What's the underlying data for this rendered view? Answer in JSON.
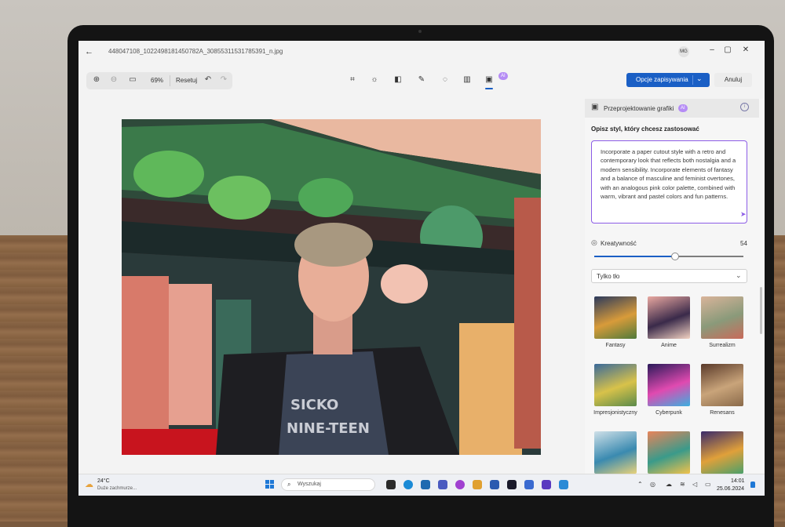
{
  "window": {
    "filename": "448047108_1022498181450782A_30855311531785391_n.jpg",
    "avatar_initials": "MG",
    "controls": {
      "minimize": "–",
      "maximize": "▢",
      "close": "✕"
    }
  },
  "toolbar": {
    "zoom": "69%",
    "reset": "Resetuj",
    "ai_badge": "AI",
    "save_label": "Opcje zapisywania",
    "cancel_label": "Anuluj"
  },
  "panel": {
    "title": "Przeprojektowanie grafiki",
    "ai_badge": "AI",
    "describe_label": "Opisz styl, który chcesz zastosować",
    "prompt": "Incorporate a paper cutout style with a retro and contemporary look that reflects both nostalgia and a modern sensibility. Incorporate elements of fantasy and a balance of masculine and feminist overtones, with an analogous pink color palette, combined with warm, vibrant and pastel colors and fun patterns.",
    "creativity_label": "Kreatywność",
    "creativity_value": "54",
    "creativity_level": 0.54,
    "scope_select": "Tylko tło",
    "styles": [
      {
        "label": "Fantasy",
        "colors": [
          "#2b3a5c",
          "#d89b3a",
          "#4f7a3a"
        ]
      },
      {
        "label": "Anime",
        "colors": [
          "#e9a8a0",
          "#3a2a4a",
          "#f2d2c2"
        ]
      },
      {
        "label": "Surrealizm",
        "colors": [
          "#d9b49a",
          "#8a9a7a",
          "#c96a5a"
        ]
      },
      {
        "label": "Impresjonistyczny",
        "colors": [
          "#3a6a9a",
          "#d8c24a",
          "#5a8a4a"
        ]
      },
      {
        "label": "Cyberpunk",
        "colors": [
          "#2a1a5a",
          "#e04ab0",
          "#3ab0e0"
        ]
      },
      {
        "label": "Renesans",
        "colors": [
          "#5a3a2a",
          "#c9a47a",
          "#8a6a4a"
        ]
      },
      {
        "label": "",
        "colors": [
          "#cfe0e8",
          "#3a8ab0",
          "#e8d27a"
        ]
      },
      {
        "label": "",
        "colors": [
          "#e8845a",
          "#3a9a8a",
          "#f2c24a"
        ]
      },
      {
        "label": "",
        "colors": [
          "#3a2a6a",
          "#e0a03a",
          "#4aa06a"
        ]
      }
    ]
  },
  "taskbar": {
    "weather_temp": "24°C",
    "weather_desc": "Duże zachmurze...",
    "search_placeholder": "Wyszukaj",
    "time": "14:01",
    "date": "25.06.2024"
  },
  "colors": {
    "accent": "#1a5fc5",
    "ai_purple": "#b58cf5",
    "prompt_border": "#8c5ce6"
  }
}
